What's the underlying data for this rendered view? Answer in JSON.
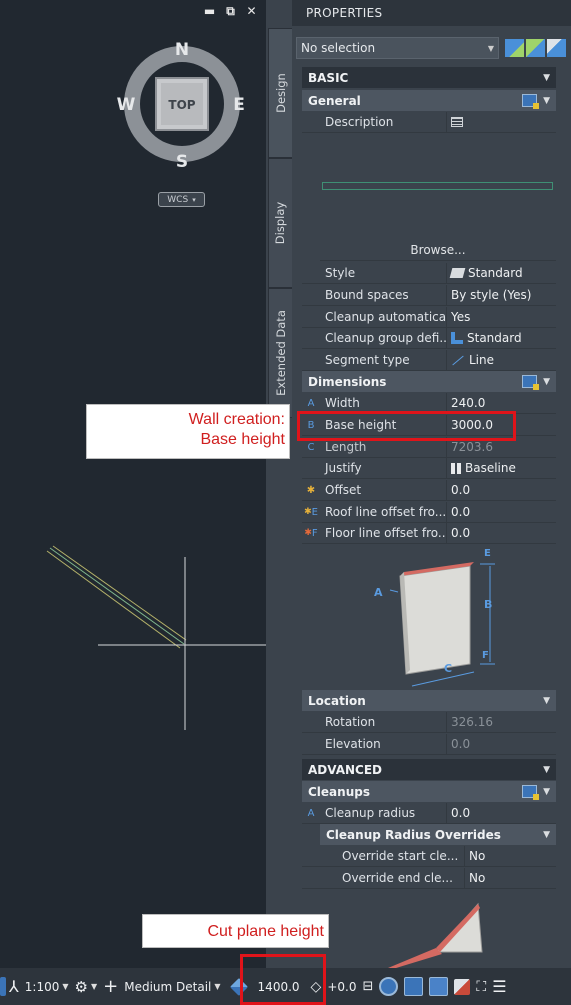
{
  "viewport": {
    "window_controls": [
      "▬",
      "⧉",
      "✕"
    ],
    "viewcube": {
      "north": "N",
      "south": "S",
      "east": "E",
      "west": "W",
      "face": "TOP"
    },
    "wcs_label": "WCS"
  },
  "sidetabs": [
    "Design",
    "Display",
    "Extended Data"
  ],
  "panel": {
    "title": "PROPERTIES",
    "selection": "No selection"
  },
  "basic": {
    "header": "BASIC",
    "general": {
      "header": "General",
      "description_label": "Description",
      "browse_label": "Browse...",
      "rows": [
        {
          "label": "Style",
          "value": "Standard"
        },
        {
          "label": "Bound spaces",
          "value": "By style (Yes)"
        },
        {
          "label": "Cleanup automatica...",
          "value": "Yes"
        },
        {
          "label": "Cleanup group defi...",
          "value": "Standard"
        },
        {
          "label": "Segment type",
          "value": "Line"
        }
      ]
    },
    "dimensions": {
      "header": "Dimensions",
      "rows": [
        {
          "marker": "A",
          "label": "Width",
          "value": "240.0"
        },
        {
          "marker": "B",
          "label": "Base height",
          "value": "3000.0"
        },
        {
          "marker": "C",
          "label": "Length",
          "value": "7203.6"
        },
        {
          "marker": "",
          "label": "Justify",
          "value": "Baseline"
        },
        {
          "marker": "",
          "label": "Offset",
          "value": "0.0"
        },
        {
          "marker": "E",
          "label": "Roof line offset fro...",
          "value": "0.0"
        },
        {
          "marker": "F",
          "label": "Floor line offset fro...",
          "value": "0.0"
        }
      ],
      "diagram_labels": [
        "A",
        "B",
        "C",
        "E",
        "F"
      ]
    },
    "location": {
      "header": "Location",
      "rows": [
        {
          "label": "Rotation",
          "value": "326.16"
        },
        {
          "label": "Elevation",
          "value": "0.0"
        }
      ]
    }
  },
  "advanced": {
    "header": "ADVANCED",
    "cleanups": {
      "header": "Cleanups",
      "radius_marker": "A",
      "radius_label": "Cleanup radius",
      "radius_value": "0.0",
      "overrides_header": "Cleanup Radius Overrides",
      "override_rows": [
        {
          "label": "Override start cle...",
          "value": "No"
        },
        {
          "label": "Override end cle...",
          "value": "No"
        }
      ]
    }
  },
  "annotations": {
    "wall_creation_line1": "Wall creation:",
    "wall_creation_line2": "Base height",
    "cut_plane": "Cut plane height"
  },
  "statusbar": {
    "scale": "1:100",
    "detail": "Medium Detail",
    "cut_plane_value": "1400.0",
    "elevation": "+0.0"
  }
}
